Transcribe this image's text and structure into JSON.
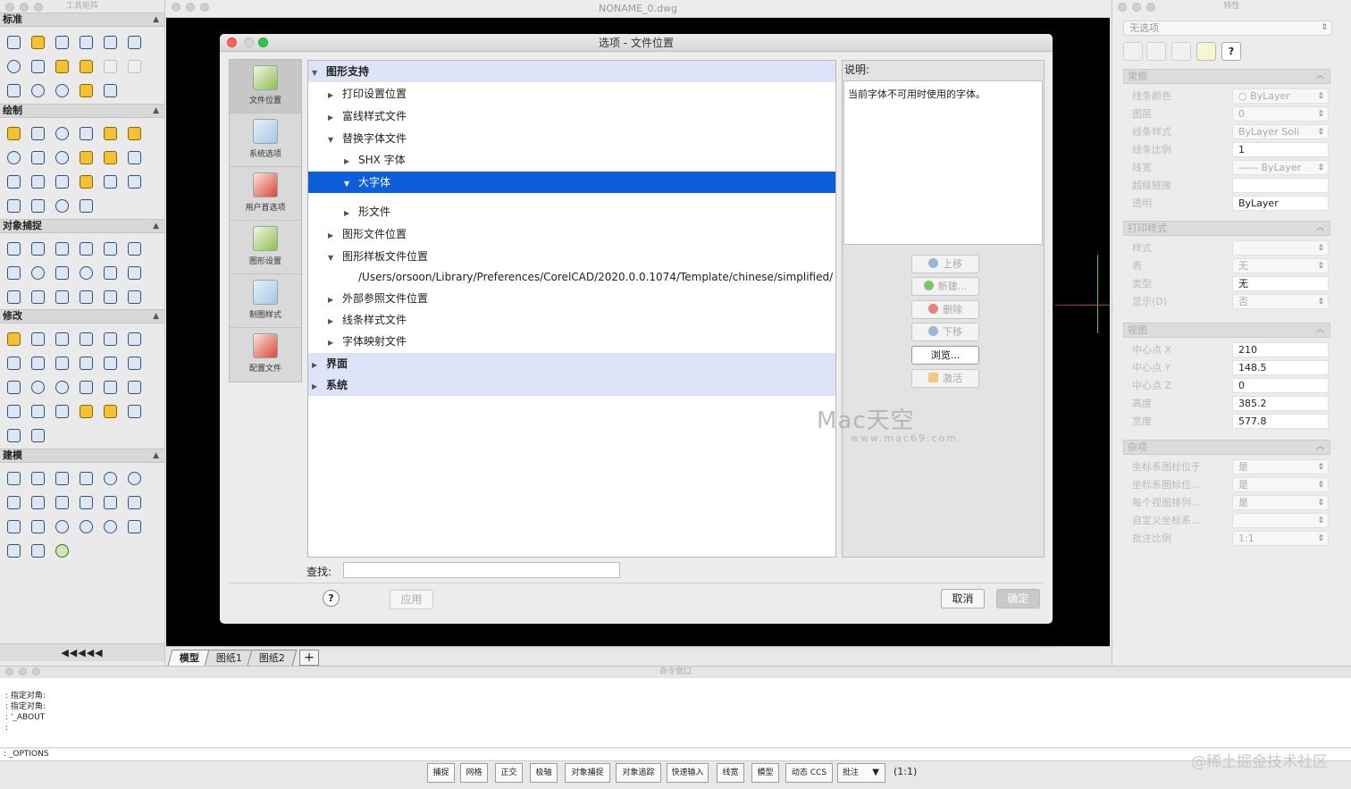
{
  "toolbox": {
    "title": "工具矩阵",
    "sections": [
      "标准",
      "绘制",
      "对象捕捉",
      "修改",
      "建模"
    ],
    "collapse_label": "◀◀◀◀◀"
  },
  "drawing": {
    "title": "NONAME_0.dwg",
    "tabs": [
      "模型",
      "图纸1",
      "图纸2"
    ],
    "add_tab": "+"
  },
  "dialog": {
    "title": "选项 - 文件位置",
    "sidebar": [
      "文件位置",
      "系统选项",
      "用户首选项",
      "图形设置",
      "制图样式",
      "配置文件"
    ],
    "tree": [
      {
        "label": "图形支持",
        "arrow": "▼",
        "level": 0,
        "type": "header"
      },
      {
        "label": "打印设置位置",
        "arrow": "▶",
        "level": 1
      },
      {
        "label": "富线样式文件",
        "arrow": "▶",
        "level": 1
      },
      {
        "label": "替换字体文件",
        "arrow": "▼",
        "level": 1
      },
      {
        "label": "SHX 字体",
        "arrow": "▶",
        "level": 2
      },
      {
        "label": "大字体",
        "arrow": "▼",
        "level": 2,
        "type": "selected"
      },
      {
        "label": "形文件",
        "arrow": "▶",
        "level": 2
      },
      {
        "label": "图形文件位置",
        "arrow": "▶",
        "level": 1
      },
      {
        "label": "图形样板文件位置",
        "arrow": "▼",
        "level": 1
      },
      {
        "label": "/Users/orsoon/Library/Preferences/CorelCAD/2020.0.0.1074/Template/chinese/simplified/",
        "arrow": "",
        "level": 2
      },
      {
        "label": "外部参照文件位置",
        "arrow": "▶",
        "level": 1
      },
      {
        "label": "线条样式文件",
        "arrow": "▶",
        "level": 1
      },
      {
        "label": "字体映射文件",
        "arrow": "▶",
        "level": 1
      },
      {
        "label": "界面",
        "arrow": "▶",
        "level": 0,
        "type": "header"
      },
      {
        "label": "系统",
        "arrow": "▶",
        "level": 0,
        "type": "header"
      }
    ],
    "description_label": "说明:",
    "description_text": "当前字体不可用时使用的字体。",
    "buttons": {
      "move_up": "上移",
      "new": "新建...",
      "delete": "删除",
      "move_down": "下移",
      "browse": "浏览...",
      "activate": "激活"
    },
    "find_label": "查找:",
    "find_value": "",
    "help": "?",
    "apply": "应用",
    "cancel": "取消",
    "ok": "确定",
    "watermark_text": "Mac天空",
    "watermark_url": "www.mac69.com"
  },
  "properties": {
    "title": "特性",
    "selection": "无选项",
    "help": "?",
    "sections": {
      "general": "常规",
      "print": "打印样式",
      "view": "视图",
      "misc": "杂项"
    },
    "general": [
      {
        "label": "线条颜色",
        "value": "ByLayer"
      },
      {
        "label": "图层",
        "value": "0"
      },
      {
        "label": "线条样式",
        "value": "ByLayer    Soli"
      },
      {
        "label": "线条比例",
        "value": "1"
      },
      {
        "label": "线宽",
        "value": "—— ByLayer"
      },
      {
        "label": "超级链接",
        "value": ""
      },
      {
        "label": "透明",
        "value": "ByLayer"
      }
    ],
    "print": [
      {
        "label": "样式",
        "value": ""
      },
      {
        "label": "表",
        "value": "无"
      },
      {
        "label": "类型",
        "value": "无"
      },
      {
        "label": "显示(D)",
        "value": "否"
      }
    ],
    "view": [
      {
        "label": "中心点 X",
        "value": "210"
      },
      {
        "label": "中心点 Y",
        "value": "148.5"
      },
      {
        "label": "中心点 Z",
        "value": "0"
      },
      {
        "label": "高度",
        "value": "385.2"
      },
      {
        "label": "宽度",
        "value": "577.8"
      }
    ],
    "misc": [
      {
        "label": "坐标系图标位于",
        "value": "是"
      },
      {
        "label": "坐标系图标位...",
        "value": "是"
      },
      {
        "label": "每个视图排列...",
        "value": "是"
      },
      {
        "label": "自定义坐标系...",
        "value": ""
      },
      {
        "label": "批注比例",
        "value": "1:1"
      }
    ]
  },
  "command": {
    "title": "命令窗口",
    "history": [
      ": 指定对角:",
      ": 指定对角:",
      ": '_ABOUT",
      ":"
    ],
    "input": ": _OPTIONS"
  },
  "status": {
    "toggles": [
      "捕捉",
      "网格",
      "正交",
      "极轴",
      "对象捕捉",
      "对象追踪",
      "快速输入",
      "线宽",
      "模型",
      "动态 CCS",
      "批注"
    ],
    "scale": "(1:1)"
  },
  "watermark": "@稀土掘金技术社区",
  "colors": {
    "selection": "#0c5fd8",
    "header_row": "#dde4f8",
    "canvas": "#000000"
  }
}
